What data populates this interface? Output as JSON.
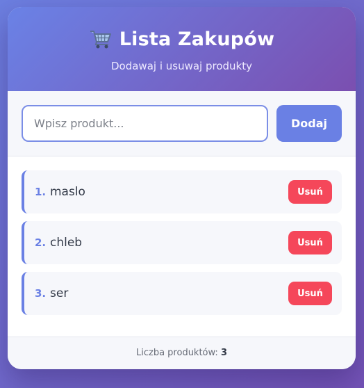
{
  "header": {
    "title": "Lista Zakupów",
    "subtitle": "Dodawaj i usuwaj produkty",
    "icon": "shopping-cart-icon"
  },
  "input": {
    "placeholder": "Wpisz produkt...",
    "value": "",
    "add_label": "Dodaj"
  },
  "items": [
    {
      "number": "1.",
      "name": "maslo",
      "remove_label": "Usuń"
    },
    {
      "number": "2.",
      "name": "chleb",
      "remove_label": "Usuń"
    },
    {
      "number": "3.",
      "name": "ser",
      "remove_label": "Usuń"
    }
  ],
  "footer": {
    "label": "Liczba produktów: ",
    "count": "3"
  },
  "colors": {
    "accent": "#6a80e4",
    "danger": "#f5475a",
    "header_gradient_start": "#6a82e6",
    "header_gradient_end": "#7b4fb0"
  }
}
